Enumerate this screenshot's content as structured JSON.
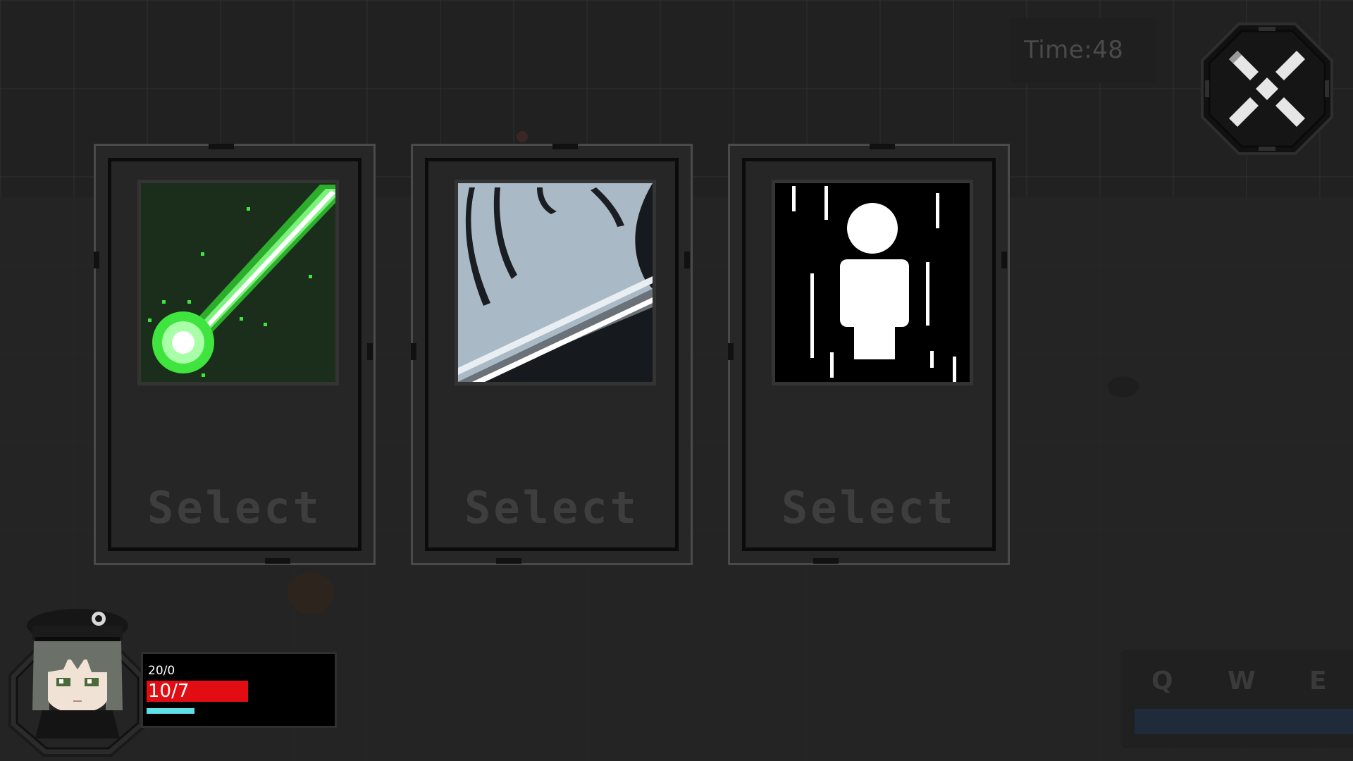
{
  "timer": {
    "label": "Time:48"
  },
  "cards": [
    {
      "art": "green-laser-beam-icon",
      "select_label": "Select",
      "accent": "#3ee83e"
    },
    {
      "art": "steel-blade-icon",
      "select_label": "Select",
      "accent": "#a9bac6"
    },
    {
      "art": "white-silhouette-figure-icon",
      "select_label": "Select",
      "accent": "#ffffff"
    }
  ],
  "player": {
    "mana_text": "20/0",
    "hp_text": "10/7",
    "hp_color": "#e10d12",
    "xp_color": "#5fe0e6"
  },
  "skills": {
    "keys": [
      "Q",
      "W",
      "E"
    ]
  }
}
